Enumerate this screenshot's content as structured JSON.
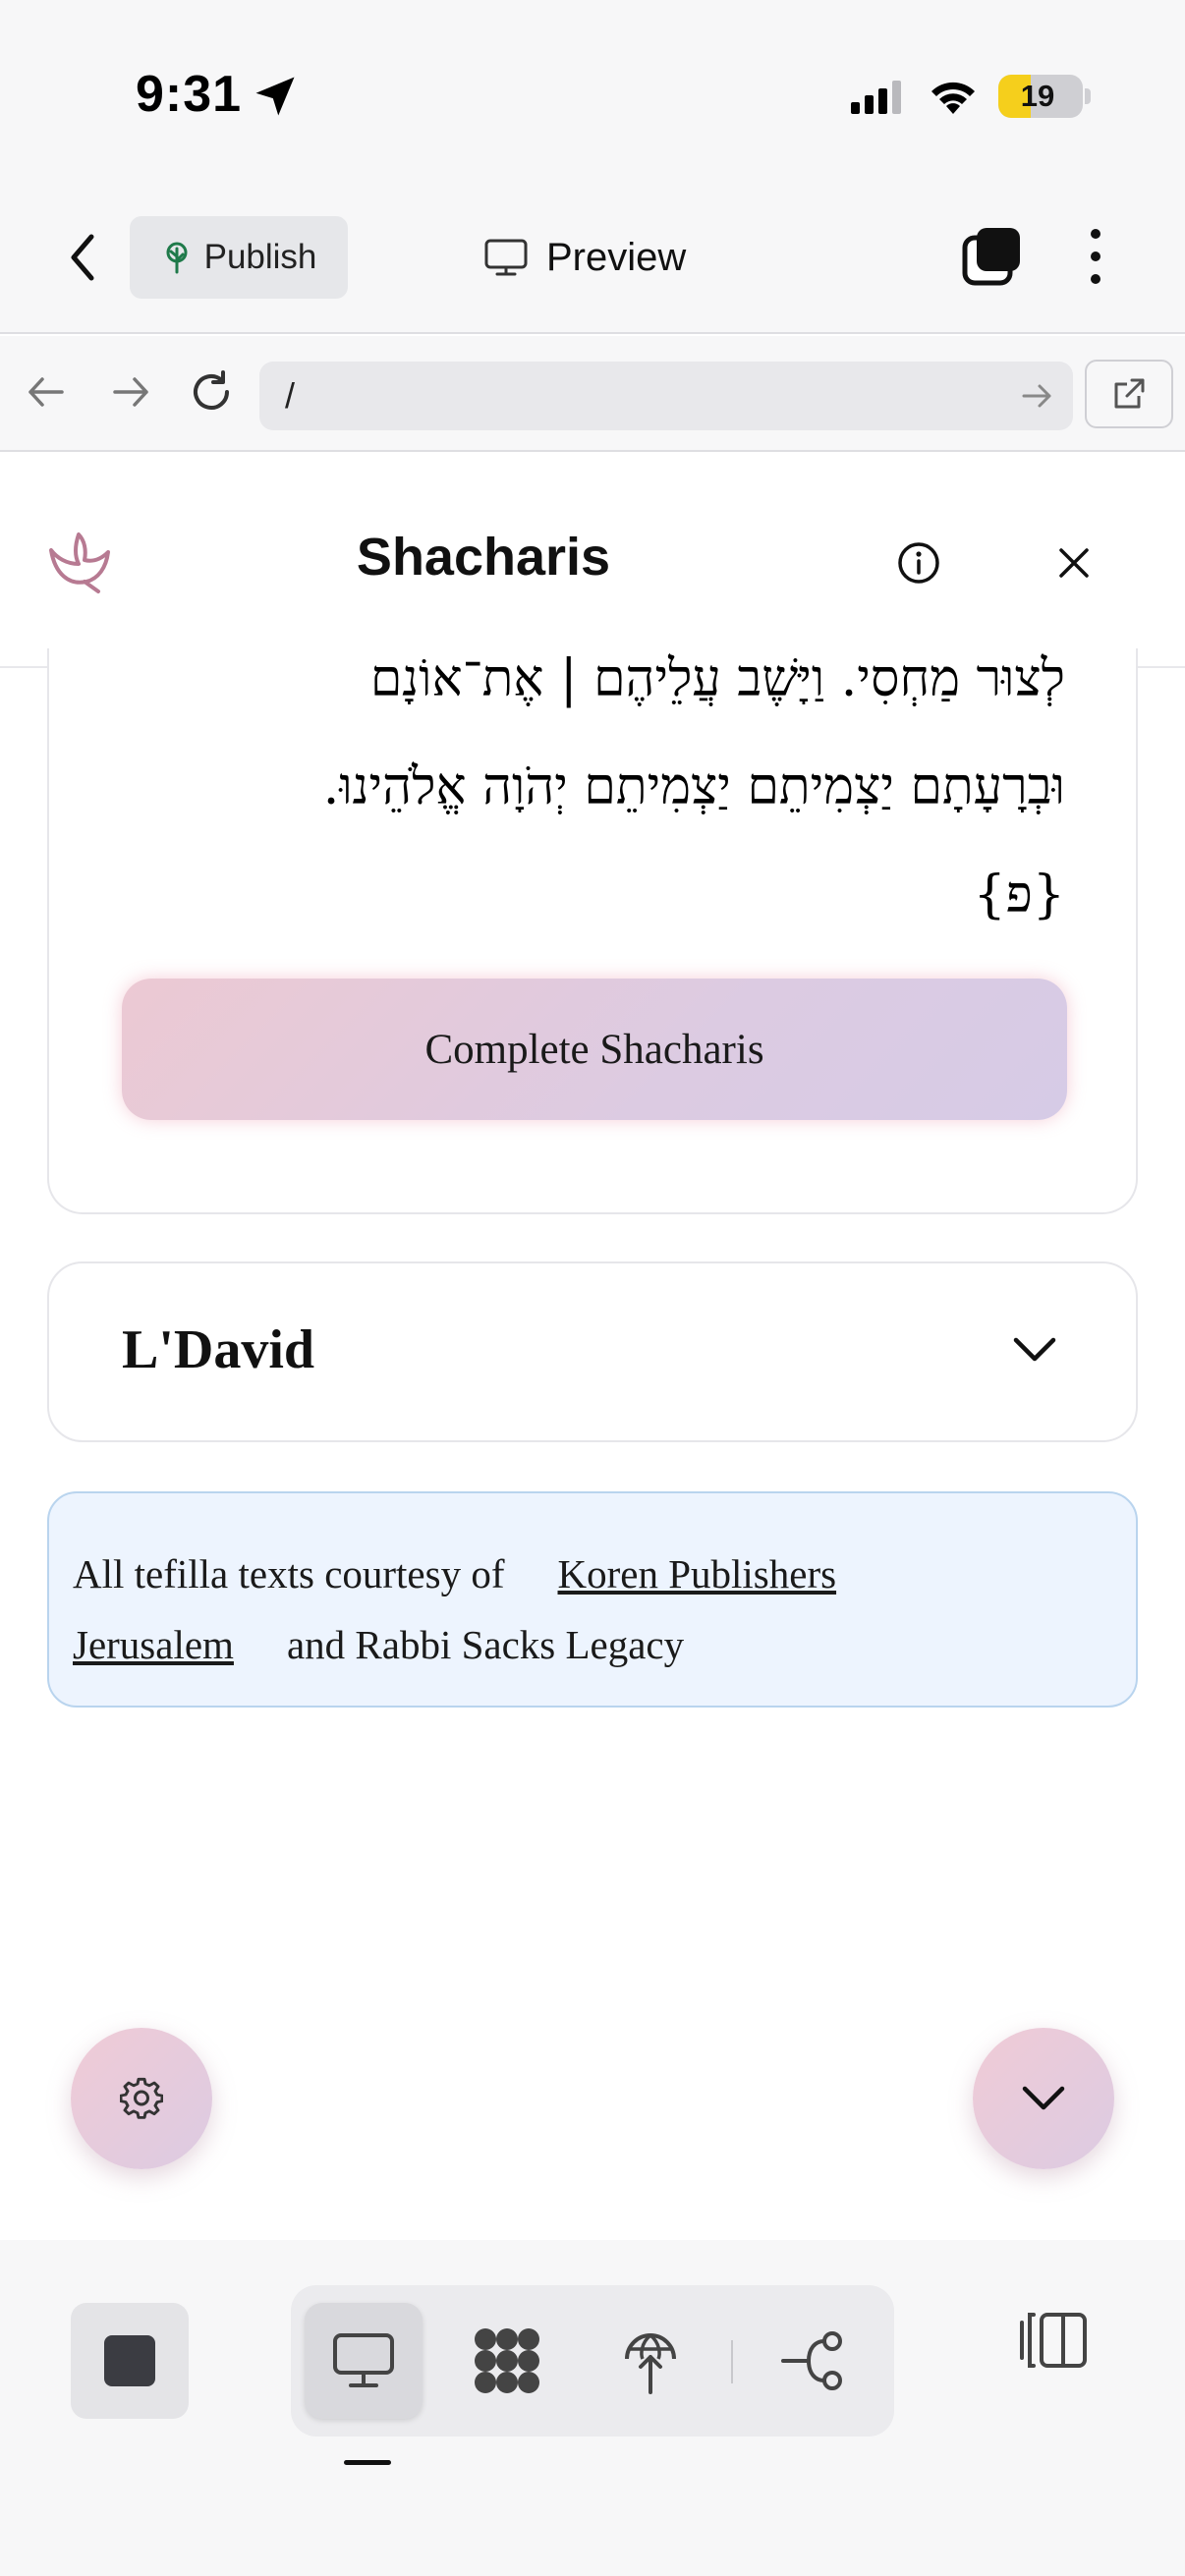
{
  "status_bar": {
    "time": "9:31",
    "battery_level": "19",
    "battery_fraction": 0.19,
    "icons": [
      "location-arrow-icon",
      "cellular-signal-icon",
      "wifi-icon",
      "battery-icon"
    ]
  },
  "toolbar": {
    "publish_label": "Publish",
    "preview_label": "Preview",
    "icons": [
      "chevron-left-icon",
      "publish-tree-icon",
      "monitor-icon",
      "stacked-windows-icon",
      "more-vertical-icon"
    ]
  },
  "url_bar": {
    "url": "/",
    "icons": [
      "arrow-left-icon",
      "arrow-right-icon",
      "reload-icon",
      "go-arrow-icon",
      "external-link-icon"
    ]
  },
  "app_header": {
    "title": "Shacharis",
    "icons": [
      "dove-logo-icon",
      "info-icon",
      "close-icon"
    ]
  },
  "prayer": {
    "hebrew_lines": [
      "לְצוּר מַחְסִי. וַיָּשֶׁב עֲלֵיהֶם | אֶת־אוֹנָם",
      "וּבְרָעָתָם יַצְמִיתֵם יַצְמִיתֵם יְהֹוָה אֱלֹהֵינוּ.",
      "{פ}"
    ],
    "complete_button": "Complete Shacharis"
  },
  "accordion": {
    "title": "L'David",
    "expanded": false
  },
  "credits": {
    "prefix": "All tefilla texts courtesy of",
    "link1_part1": "Koren Publishers",
    "link1_part2": "Jerusalem",
    "suffix": "and Rabbi Sacks Legacy"
  },
  "fabs": {
    "left_icon": "gear-icon",
    "right_icon": "chevron-down-icon"
  },
  "bottom_bar": {
    "selected_tab": "desktop",
    "icons": [
      "stop-icon",
      "desktop-icon",
      "apps-grid-icon",
      "deploy-globe-icon",
      "flow-icon",
      "side-panel-icon"
    ]
  },
  "colors": {
    "accent_pink": "#ecc9d3",
    "accent_lavender": "#d6cbe6",
    "credits_bg": "#edf4fe",
    "credits_border": "#b9d4ee",
    "battery_yellow": "#f5cf1c",
    "publish_green": "#1f7a4a",
    "logo_rose": "#b77a92"
  }
}
